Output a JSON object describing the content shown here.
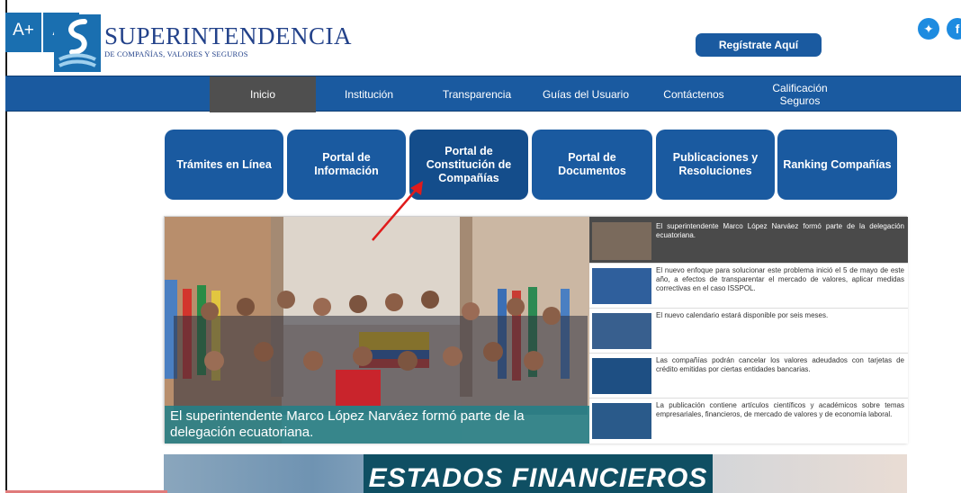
{
  "accessibility": {
    "increase_label": "A+",
    "decrease_label": "A-"
  },
  "brand": {
    "title": "SUPERINTENDENCIA",
    "subtitle": "DE COMPAÑÍAS, VALORES Y SEGUROS"
  },
  "header": {
    "register_label": "Regístrate Aquí"
  },
  "nav": {
    "items": [
      {
        "label": "Inicio"
      },
      {
        "label": "Institución"
      },
      {
        "label": "Transparencia"
      },
      {
        "label": "Guías del Usuario"
      },
      {
        "label": "Contáctenos"
      },
      {
        "label": "Calificación Seguros"
      }
    ]
  },
  "tiles": [
    {
      "label": "Trámites en Línea"
    },
    {
      "label": "Portal de Información"
    },
    {
      "label": "Portal de Constitución de Compañías"
    },
    {
      "label": "Portal de Documentos"
    },
    {
      "label": "Publicaciones y Resoluciones"
    },
    {
      "label": "Ranking Compañías"
    }
  ],
  "news": {
    "caption": "El superintendente Marco López Narváez formó parte de la delegación ecuatoriana.",
    "items": [
      {
        "text": "El superintendente Marco López Narváez formó parte de la delegación ecuatoriana."
      },
      {
        "text": "El nuevo enfoque para solucionar este problema inició el 5 de mayo de este año, a efectos de transparentar el mercado de valores, aplicar medidas correctivas en el caso ISSPOL."
      },
      {
        "text": "El nuevo calendario estará disponible por seis meses."
      },
      {
        "text": "Las compañías podrán cancelar los valores adeudados con tarjetas de crédito emitidas por ciertas entidades bancarias."
      },
      {
        "text": "La publicación contiene artículos científicos y académicos sobre temas empresariales, financieros, de mercado de valores y de economía laboral."
      }
    ]
  },
  "banner": {
    "title": "ESTADOS FINANCIEROS"
  },
  "colors": {
    "primary": "#1a5aa0",
    "nav_active": "#4f4f4f",
    "caption_bg": "#238087",
    "annotation_arrow": "#e01b1b"
  }
}
